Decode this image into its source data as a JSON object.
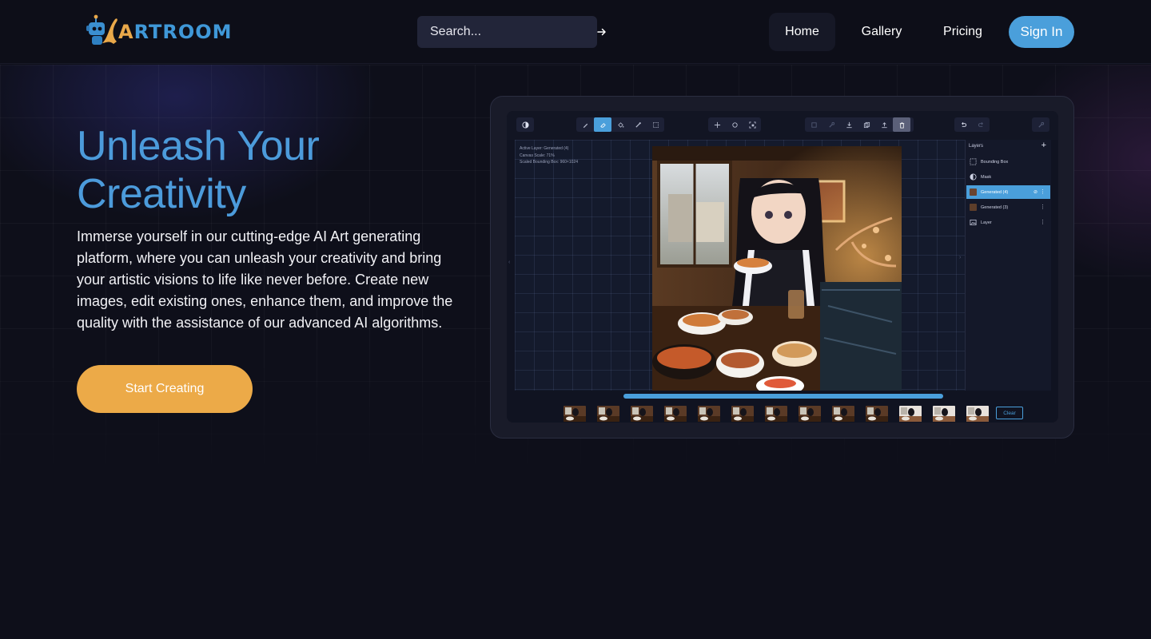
{
  "header": {
    "logo_text_first": "A",
    "logo_text_rest": "RTROOM",
    "search": {
      "placeholder": "Search...",
      "icon": "arrow-right-icon"
    },
    "nav": [
      {
        "label": "Home",
        "active": true
      },
      {
        "label": "Gallery",
        "active": false
      },
      {
        "label": "Pricing",
        "active": false
      }
    ],
    "signin_label": "Sign In"
  },
  "hero": {
    "headline": "Unleash Your Creativity",
    "description": "Immerse yourself in our cutting-edge AI Art generating platform, where you can unleash your creativity and bring your artistic visions to life like never before. Create new images, edit existing ones, enhance them, and improve the quality with the assistance of our advanced AI algorithms.",
    "cta_label": "Start Creating"
  },
  "preview": {
    "canvas_info": {
      "active_layer": "Active Layer: Generated (4)",
      "canvas_scale": "Canvas Scale: 71%",
      "bounding_box": "Scaled Bounding Box: 960×1024"
    },
    "layers_title": "Layers",
    "layers": [
      {
        "label": "Bounding Box",
        "icon": "dashed-square-icon",
        "selected": false
      },
      {
        "label": "Mask",
        "icon": "half-circle-icon",
        "selected": false
      },
      {
        "label": "Generated (4)",
        "icon": "thumbnail",
        "selected": true
      },
      {
        "label": "Generated (3)",
        "icon": "thumbnail",
        "selected": false
      },
      {
        "label": "Layer",
        "icon": "image-icon",
        "selected": false
      }
    ],
    "progress_fraction": 1.0,
    "thumbnail_count": 13,
    "clear_label": "Clear"
  },
  "colors": {
    "background": "#0e0f1a",
    "accent_blue": "#4a9fdb",
    "accent_orange": "#ecaa48"
  }
}
